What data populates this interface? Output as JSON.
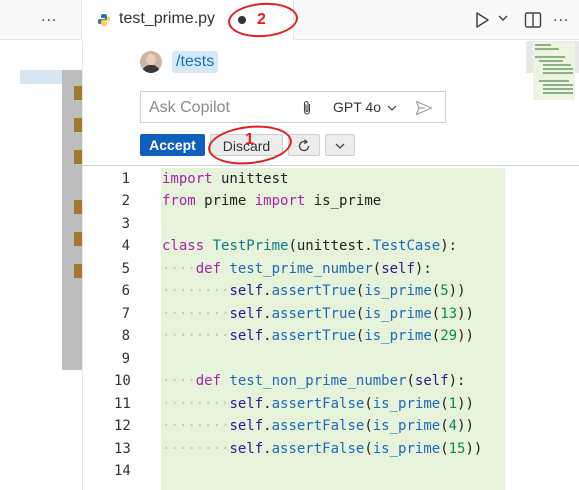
{
  "tabbar": {
    "left_more": "...",
    "tab_title": "test_prime.py",
    "right_more": "..."
  },
  "annotations": {
    "one": "1",
    "two": "2"
  },
  "chat": {
    "chip": "/tests",
    "placeholder": "Ask Copilot",
    "model": "GPT 4o",
    "accept_label": "Accept",
    "discard_label": "Discard"
  },
  "code": {
    "line_numbers": [
      "1",
      "2",
      "3",
      "4",
      "5",
      "6",
      "7",
      "8",
      "9",
      "10",
      "11",
      "12",
      "13",
      "14"
    ],
    "lines": [
      "import unittest",
      "from prime import is_prime",
      "",
      "class TestPrime(unittest.TestCase):",
      "    def test_prime_number(self):",
      "        self.assertTrue(is_prime(5))",
      "        self.assertTrue(is_prime(13))",
      "        self.assertTrue(is_prime(29))",
      "",
      "    def test_non_prime_number(self):",
      "        self.assertFalse(is_prime(1))",
      "        self.assertFalse(is_prime(4))",
      "        self.assertFalse(is_prime(15))",
      ""
    ]
  },
  "colors": {
    "accent": "#0f5fbd",
    "diff_added": "#e6f2da",
    "annotation": "#e02020"
  }
}
